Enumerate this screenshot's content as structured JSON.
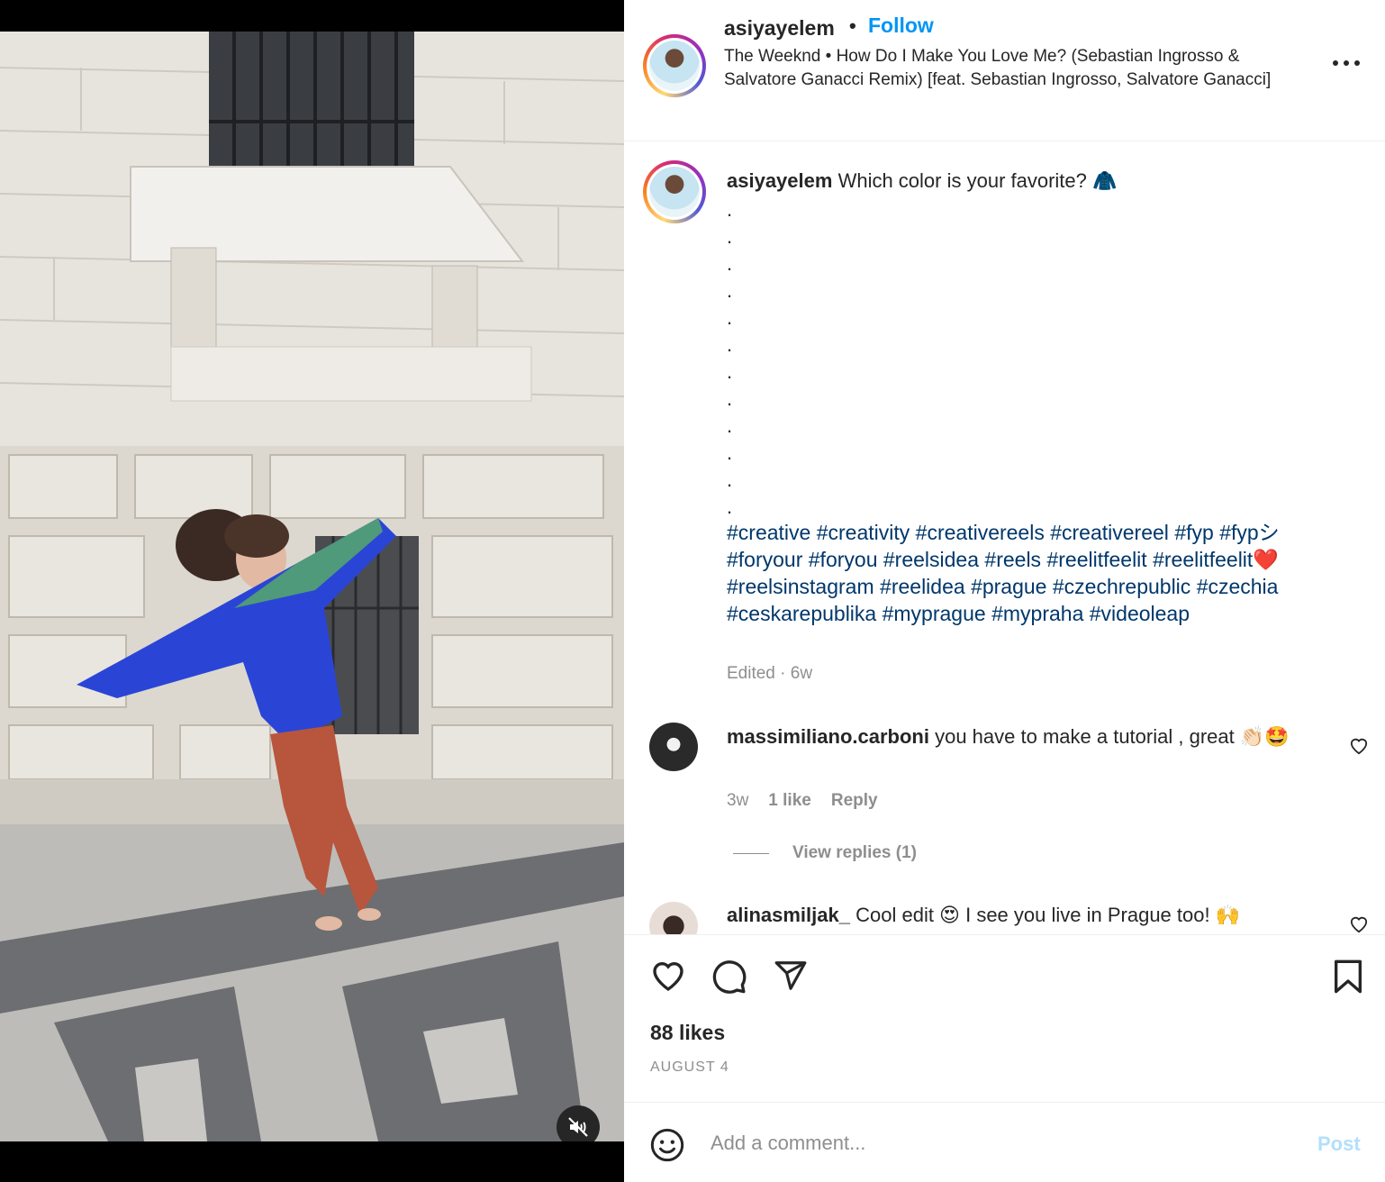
{
  "post": {
    "username": "asiyayelem",
    "separator": "•",
    "follow_label": "Follow",
    "audio": "The Weeknd • How Do I Make You Love Me? (Sebastian Ingrosso & Salvatore Ganacci Remix) [feat. Sebastian Ingrosso, Salvatore Ganacci]",
    "more_icon": "more-horizontal-icon"
  },
  "caption": {
    "username": "asiyayelem",
    "text": "Which color is your favorite? 🧥",
    "dots": [
      ".",
      ".",
      ".",
      ".",
      ".",
      ".",
      ".",
      ".",
      ".",
      ".",
      ".",
      "."
    ],
    "hashtags": [
      "#creative",
      "#creativity",
      "#creativereels",
      "#creativereel",
      "#fyp",
      "#fypシ",
      "#foryour",
      "#foryou",
      "#reelsidea",
      "#reels",
      "#reelitfeelit",
      "#reelitfeelit❤️",
      "#reelsinstagram",
      "#reelidea",
      "#prague",
      "#czechrepublic",
      "#czechia",
      "#ceskarepublika",
      "#myprague",
      "#mypraha",
      "#videoleap"
    ],
    "meta": "Edited · 6w"
  },
  "comments": [
    {
      "username": "massimiliano.carboni",
      "text": "you have to make a tutorial , great 👏🏻🤩",
      "time": "3w",
      "likes": "1 like",
      "reply_label": "Reply",
      "view_replies": "View replies (1)"
    },
    {
      "username": "alinasmiljak_",
      "text": "Cool edit 😍 I see you live in Prague too! 🙌"
    }
  ],
  "actions": {
    "like_icon": "heart-icon",
    "comment_icon": "comment-icon",
    "share_icon": "share-icon",
    "save_icon": "bookmark-icon"
  },
  "likes": "88 likes",
  "date": "AUGUST 4",
  "add_comment": {
    "emoji_icon": "emoji-icon",
    "placeholder": "Add a comment...",
    "post_label": "Post"
  },
  "colors": {
    "link_blue": "#0095f6",
    "hashtag_blue": "#00376b",
    "secondary_text": "#8e8e8e",
    "post_disabled": "#b2dffc"
  }
}
